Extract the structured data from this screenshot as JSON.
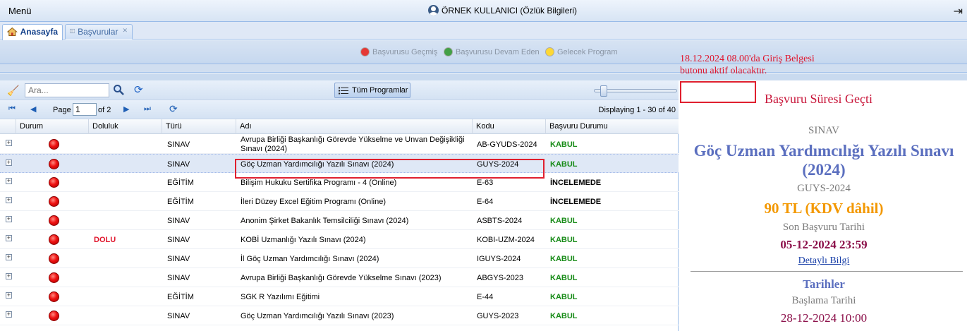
{
  "topbar": {
    "menu_label": "Menü",
    "user_label": "ÖRNEK KULLANICI (Özlük Bilgileri)",
    "logout_icon": "logout-icon"
  },
  "tabs": [
    {
      "label": "Anasayfa",
      "icon": "home-icon",
      "active": true
    },
    {
      "label": "Başvurular",
      "icon": "list-icon",
      "active": false
    }
  ],
  "legend": [
    {
      "label": "Başvurusu Geçmiş",
      "color": "#e53935"
    },
    {
      "label": "Başvurusu Devam Eden",
      "color": "#43a047"
    },
    {
      "label": "Gelecek Program",
      "color": "#fdd835"
    }
  ],
  "notice": {
    "line1": "18.12.2024 08.00'da Giriş Belgesi",
    "line2": "butonu aktif olacaktır."
  },
  "toolbar": {
    "search_placeholder": "Ara...",
    "all_programs_label": "Tüm Programlar"
  },
  "pager": {
    "page_label": "Page",
    "page_value": "1",
    "of_label": "of 2",
    "displaying": "Displaying 1 - 30 of 40"
  },
  "columns": [
    "Durum",
    "Doluluk",
    "Türü",
    "Adı",
    "Kodu",
    "Başvuru Durumu"
  ],
  "rows": [
    {
      "doluluk": "",
      "turu": "SINAV",
      "adi": "Avrupa Birliği Başkanlığı Görevde Yükselme ve Unvan Değişikliği Sınavı (2024)",
      "kodu": "AB-GYUDS-2024",
      "durum": "KABUL"
    },
    {
      "doluluk": "",
      "turu": "SINAV",
      "adi": "Göç Uzman Yardımcılığı Yazılı Sınavı (2024)",
      "kodu": "GUYS-2024",
      "durum": "KABUL"
    },
    {
      "doluluk": "",
      "turu": "EĞİTİM",
      "adi": "Bilişim Hukuku Sertifika Programı - 4 (Online)",
      "kodu": "E-63",
      "durum": "İNCELEMEDE"
    },
    {
      "doluluk": "",
      "turu": "EĞİTİM",
      "adi": "İleri Düzey Excel Eğitim Programı (Online)",
      "kodu": "E-64",
      "durum": "İNCELEMEDE"
    },
    {
      "doluluk": "",
      "turu": "SINAV",
      "adi": "Anonim Şirket Bakanlık Temsilciliği Sınavı (2024)",
      "kodu": "ASBTS-2024",
      "durum": "KABUL"
    },
    {
      "doluluk": "DOLU",
      "turu": "SINAV",
      "adi": "KOBİ Uzmanlığı Yazılı Sınavı (2024)",
      "kodu": "KOBI-UZM-2024",
      "durum": "KABUL"
    },
    {
      "doluluk": "",
      "turu": "SINAV",
      "adi": "İl Göç Uzman Yardımcılığı Sınavı (2024)",
      "kodu": "IGUYS-2024",
      "durum": "KABUL"
    },
    {
      "doluluk": "",
      "turu": "SINAV",
      "adi": "Avrupa Birliği Başkanlığı Görevde Yükselme Sınavı (2023)",
      "kodu": "ABGYS-2023",
      "durum": "KABUL"
    },
    {
      "doluluk": "",
      "turu": "EĞİTİM",
      "adi": "SGK R Yazılımı Eğitimi",
      "kodu": "E-44",
      "durum": "KABUL"
    },
    {
      "doluluk": "",
      "turu": "SINAV",
      "adi": "Göç Uzman Yardımcılığı Yazılı Sınavı (2023)",
      "kodu": "GUYS-2023",
      "durum": "KABUL"
    }
  ],
  "detail": {
    "expired": "Başvuru Süresi Geçti",
    "type": "SINAV",
    "title": "Göç Uzman Yardımcılığı Yazılı Sınavı (2024)",
    "code": "GUYS-2024",
    "price": "90 TL (KDV dâhil)",
    "deadline_label": "Son Başvuru Tarihi",
    "deadline": "05-12-2024 23:59",
    "detail_link": "Detaylı Bilgi",
    "dates_header": "Tarihler",
    "start_label": "Başlama Tarihi",
    "start": "28-12-2024 10:00"
  },
  "colors": {
    "accent": "#15428b",
    "kabul": "#178b17",
    "expired": "#c8163a",
    "price": "#f39800"
  }
}
